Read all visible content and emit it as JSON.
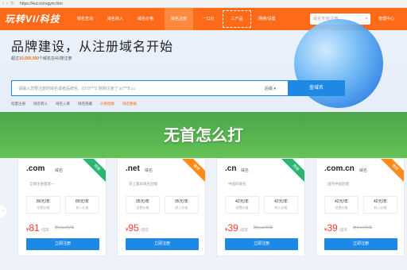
{
  "browser": {
    "url": "https://4ut.cn/regym.htm"
  },
  "nav": {
    "logo": "玩转VI/科技",
    "items": [
      "域名查询",
      "域名转入",
      "域名价格",
      "域名注册",
      "一口价",
      "三产品",
      "网络/设置"
    ],
    "search_placeholder": "域名查询/注册",
    "manage": "管理中心"
  },
  "hero": {
    "title": "品牌建设，从注册域名开始",
    "sub_prefix": "超过",
    "sub_count": "10,000,000",
    "sub_suffix": "个域名在4U搜注册",
    "search_placeholder": "请输入您要注册的域名或者品牌名、ID79***2 刚刚注册了 zc***8.cc",
    "select_label": "后缀",
    "search_button": "查域名",
    "links": [
      "批量注册",
      "域名转入",
      "域名入库",
      "域名隐藏",
      "价格指数",
      "域名数据"
    ]
  },
  "overlay": {
    "text": "无首怎么打"
  },
  "cards": [
    {
      "tld": ".com",
      "name": "域名",
      "ribbon": "热销",
      "desc": "全球注册量第一",
      "p1": "89元/年",
      "l1": "续费价格",
      "p2": "89元/年",
      "l2": "转入价格",
      "price": "81",
      "unit": "/首年",
      "old": "原价89元/年",
      "button": "立即注册"
    },
    {
      "tld": ".net",
      "name": "域名",
      "ribbon": "推荐",
      "desc": "史上最早域名后缀",
      "p1": "95元/年",
      "l1": "续费价格",
      "p2": "95元/年",
      "l2": "转入价格",
      "price": "95",
      "unit": "/首年",
      "old": "",
      "button": "立即注册"
    },
    {
      "tld": ".cn",
      "name": "域名",
      "ribbon": "热销",
      "desc": "中国的域名",
      "p1": "42元/年",
      "l1": "续费价格",
      "p2": "42元/年",
      "l2": "转入价格",
      "price": "39",
      "unit": "/首年",
      "old": "原价42元/年",
      "button": "立即注册"
    },
    {
      "tld": ".com.cn",
      "name": "域名",
      "ribbon": "推荐",
      "desc": "国内中国后缀",
      "p1": "42元/年",
      "l1": "续费价格",
      "p2": "42元/年",
      "l2": "转入价格",
      "price": "39",
      "unit": "/首年",
      "old": "原价47元/年",
      "button": "立即注册"
    }
  ],
  "colors": {
    "brand": "#ff6a19",
    "accent": "#1e88e5",
    "overlay": "#48a844"
  }
}
